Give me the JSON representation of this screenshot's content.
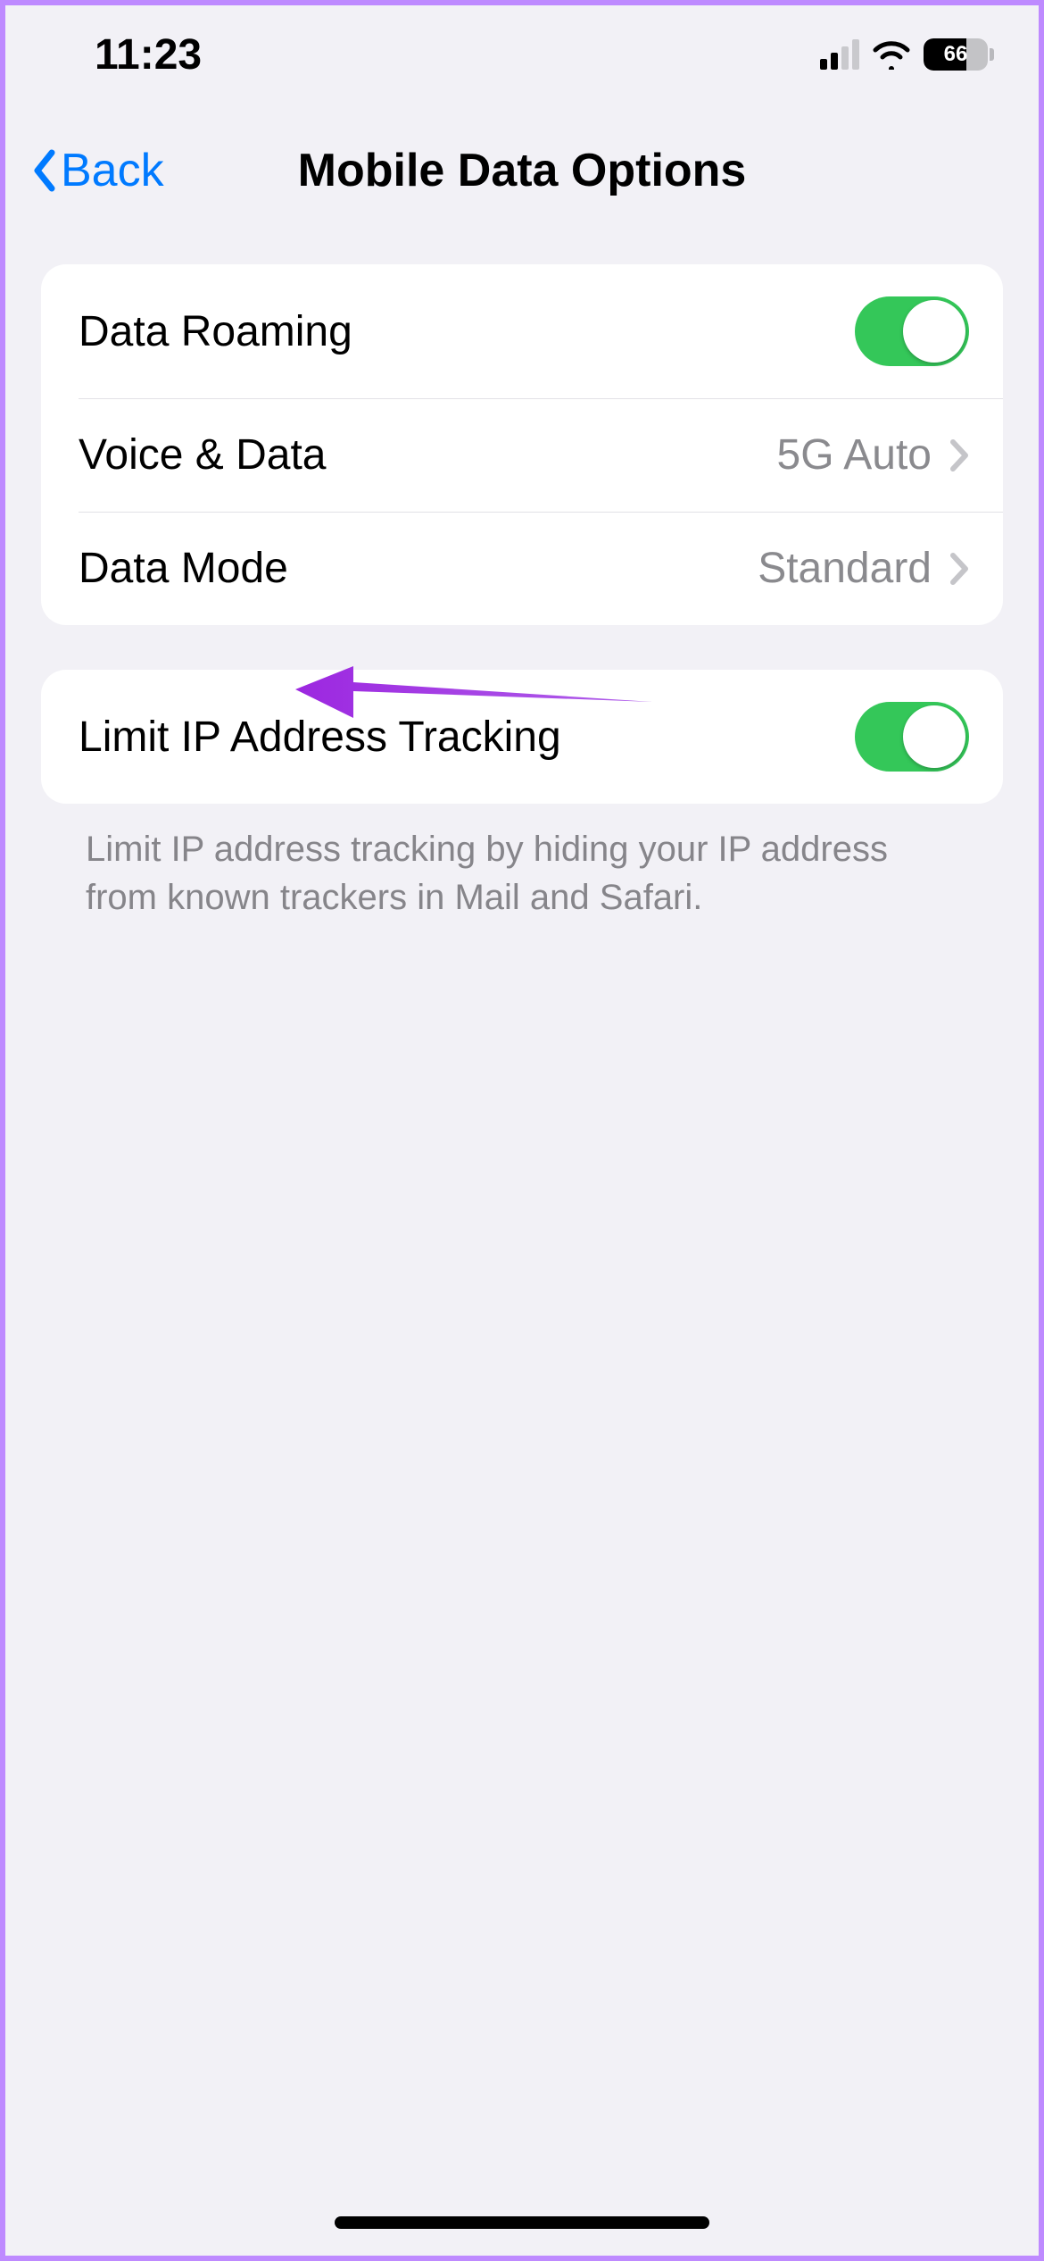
{
  "statusbar": {
    "time": "11:23",
    "cellular_bars_active": 2,
    "battery_percent": "66"
  },
  "nav": {
    "back_label": "Back",
    "title": "Mobile Data Options"
  },
  "group1": {
    "roaming_label": "Data Roaming",
    "roaming_on": true,
    "voice_label": "Voice & Data",
    "voice_value": "5G Auto",
    "mode_label": "Data Mode",
    "mode_value": "Standard"
  },
  "group2": {
    "limit_label": "Limit IP Address Tracking",
    "limit_on": true,
    "footer": "Limit IP address tracking by hiding your IP address from known trackers in Mail and Safari."
  },
  "colors": {
    "accent_blue": "#007aff",
    "toggle_green": "#34c759",
    "arrow_purple": "#9c27e0"
  }
}
